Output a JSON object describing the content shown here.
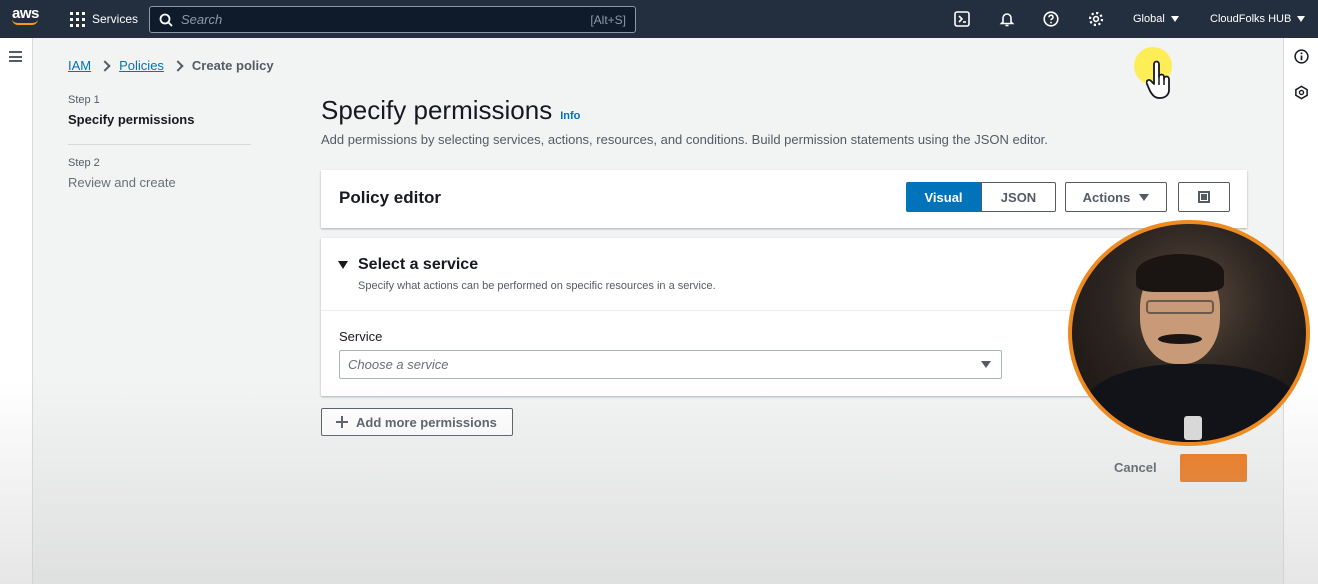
{
  "nav": {
    "logo_text": "aws",
    "services_label": "Services",
    "search_placeholder": "Search",
    "search_shortcut": "[Alt+S]",
    "region": "Global",
    "account": "CloudFolks HUB"
  },
  "breadcrumb": {
    "items": [
      "IAM",
      "Policies"
    ],
    "current": "Create policy"
  },
  "steps": [
    {
      "number": "Step 1",
      "title": "Specify permissions"
    },
    {
      "number": "Step 2",
      "title": "Review and create"
    }
  ],
  "page": {
    "title": "Specify permissions",
    "info_link": "Info",
    "description": "Add permissions by selecting services, actions, resources, and conditions. Build permission statements using the JSON editor."
  },
  "editor": {
    "title": "Policy editor",
    "tabs": [
      "Visual",
      "JSON"
    ],
    "active_tab": "Visual",
    "actions_label": "Actions"
  },
  "service_section": {
    "title": "Select a service",
    "subtitle": "Specify what actions can be performed on specific resources in a service.",
    "field_label": "Service",
    "select_placeholder": "Choose a service"
  },
  "add_permissions_label": "Add more permissions",
  "footer": {
    "cancel_label": "Cancel"
  },
  "colors": {
    "nav_bg": "#232f3e",
    "primary_blue": "#0073bb",
    "accent_orange": "#ec7211",
    "webcam_ring": "#ee8a22"
  }
}
